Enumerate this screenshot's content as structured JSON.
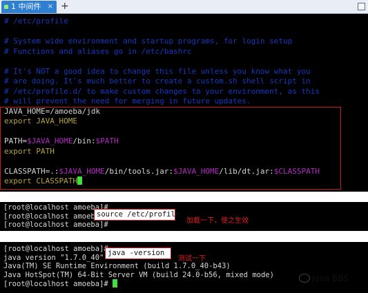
{
  "tab": {
    "label": "1 中间件",
    "close": "×",
    "add": "+"
  },
  "editor_lines": {
    "c1": "# /etc/profile",
    "c2": "# System wide environment and startup programs, for login setup",
    "c3": "# Functions and aliases go in /etc/bashrc",
    "c4": "# It's NOT a good idea to change this file unless you know what you",
    "c5": "# are doing. It's much better to create a custom.sh shell script in",
    "c6": "# /etc/profile.d/ to make custom changes to your environment, as this",
    "c7": "# will prevent the need for merging in future updates.",
    "java_home_name": "JAVA_HOME",
    "java_home_value": "=/amoeba/jdk",
    "export_java_home": "export JAVA_HOME",
    "path_name": "PATH",
    "path_eq": "=",
    "path_ref": "$JAVA_HOME",
    "path_suffix": "/bin:",
    "path_ref2": "$PATH",
    "export_path": "export PATH",
    "cp_name": "CLASSPATH",
    "cp_eq": "=.:",
    "cp_ref1": "$JAVA_HOME",
    "cp_mid1": "/bin/tools.jar:",
    "cp_ref2": "$JAVA_HOME",
    "cp_mid2": "/lib/dt.jar:",
    "cp_ref3": "$CLASSPATH",
    "export_cp": "export CLASSPATH"
  },
  "source_terminal": {
    "line1": "[root@localhost amoeba]#",
    "line2": "[root@localhost amoeba]#",
    "line3": "[root@localhost amoeba]#",
    "command": "source /etc/profile",
    "annotation": "加载一下，使之生效"
  },
  "version_terminal": {
    "prompt1": "[root@localhost amoeba]#",
    "command": "java -version",
    "annotation": "测试一下",
    "out1": "java version \"1.7.0_40\"",
    "out2": "Java(TM) SE Runtime Environment (build 1.7.0_40-b43)",
    "out3": "Java HotSpot(TM) 64-Bit Server VM (build 24.0-b56, mixed mode)",
    "prompt2": "[root@localhost amoeba]#"
  },
  "watermark": "Java BBS",
  "colors": {
    "comment": "#1638c0",
    "variable_ref": "#b22ac0",
    "keyword": "#b7a43a",
    "annotation": "#e02020",
    "highlight_border": "#d01818"
  }
}
